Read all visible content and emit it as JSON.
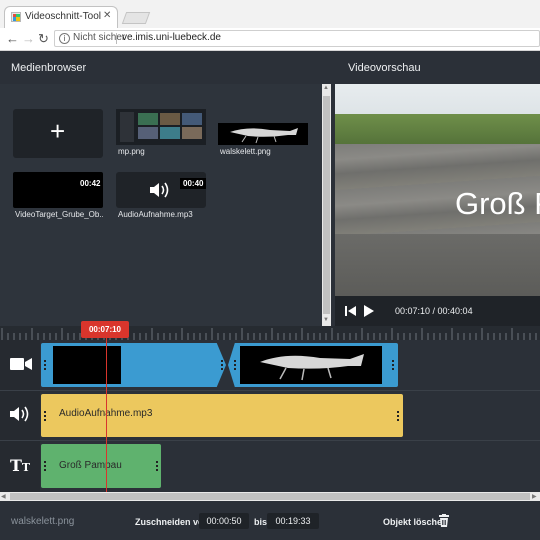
{
  "browser": {
    "tab_title": "Videoschnitt-Tool",
    "tab_close": "✕",
    "security_label": "Nicht sicher",
    "url": "ve.imis.uni-luebeck.de"
  },
  "media_browser": {
    "title": "Medienbrowser",
    "add_symbol": "+",
    "items": [
      {
        "label": "mp.png",
        "duration": ""
      },
      {
        "label": "walskelett.png",
        "duration": ""
      },
      {
        "label": "VideoTarget_Grube_Ob...",
        "duration": "00:42"
      },
      {
        "label": "AudioAufnahme.mp3",
        "duration": "00:40"
      }
    ]
  },
  "video_preview": {
    "title": "Videovorschau",
    "overlay_text": "Groß P",
    "time": "00:07:10 / 00:40:04"
  },
  "timeline": {
    "playhead_time": "00:07:10",
    "playhead_progress": 0.178,
    "audio_clip": "AudioAufnahme.mp3",
    "text_clip": "Groß Pampau"
  },
  "footer": {
    "selected_name": "walskelett.png",
    "crop_label": "Zuschneiden von",
    "crop_from": "00:00:50",
    "crop_to_label": "bis",
    "crop_to": "00:19:33",
    "delete_label": "Objekt löschen"
  },
  "colors": {
    "video_track": "#3b9bd1",
    "audio_track": "#ecc85e",
    "text_track": "#5fb26e",
    "playhead": "#d9352c"
  }
}
